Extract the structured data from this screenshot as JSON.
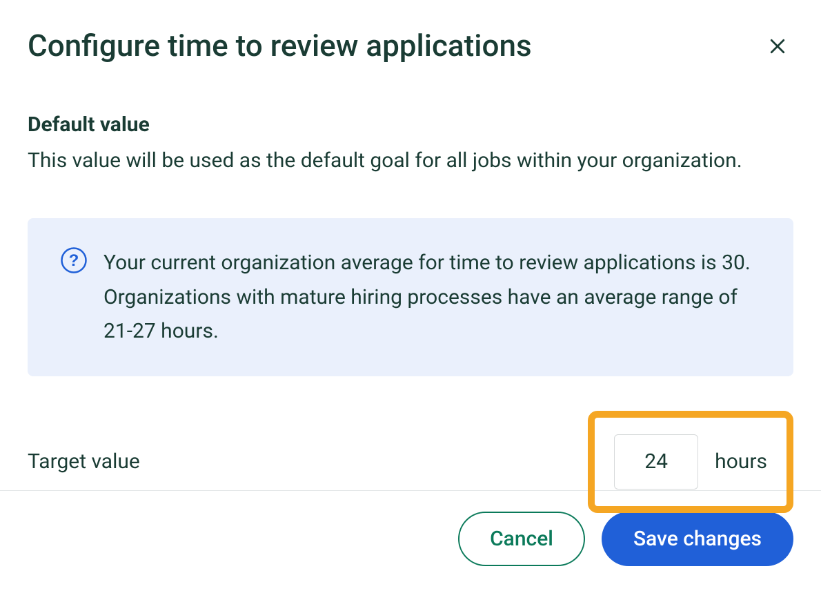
{
  "modal": {
    "title": "Configure time to review applications",
    "section": {
      "heading": "Default value",
      "description": "This value will be used as the default goal for all jobs within your organization."
    },
    "info": {
      "text": "Your current organization average for time to review applications is 30. Organizations with mature hiring processes have an average range of 21-27 hours."
    },
    "target": {
      "label": "Target value",
      "value": "24",
      "unit": "hours"
    },
    "buttons": {
      "cancel": "Cancel",
      "save": "Save changes"
    }
  }
}
